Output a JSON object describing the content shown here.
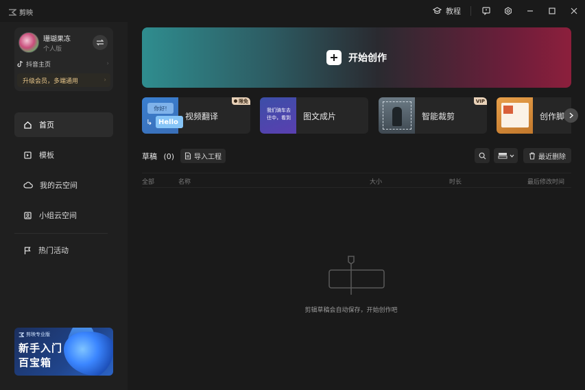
{
  "app": {
    "logo_text": "剪映"
  },
  "titlebar": {
    "tutorial_label": "教程"
  },
  "sidebar": {
    "user": {
      "name": "珊瑚果冻",
      "tier": "个人版"
    },
    "douyin_label": "抖音主页",
    "upgrade_label": "升级会员，多端通用",
    "nav": [
      {
        "label": "首页",
        "icon": "home-icon",
        "active": true
      },
      {
        "label": "模板",
        "icon": "template-icon",
        "active": false
      },
      {
        "label": "我的云空间",
        "icon": "cloud-icon",
        "active": false
      },
      {
        "label": "小组云空间",
        "icon": "team-cloud-icon",
        "active": false
      },
      {
        "label": "热门活动",
        "icon": "flag-icon",
        "active": false
      }
    ],
    "promo": {
      "brand": "剪映专业版",
      "line1": "新手入门",
      "line2": "百宝箱"
    }
  },
  "hero": {
    "label": "开始创作"
  },
  "tools": [
    {
      "label": "视频翻译",
      "badge": "限免",
      "thumb_text_1": "你好!",
      "thumb_text_2": "Hello"
    },
    {
      "label": "图文成片",
      "thumb_text": "我们骑车去往中，看到"
    },
    {
      "label": "智能裁剪",
      "badge": "VIP"
    },
    {
      "label": "创作脚本"
    }
  ],
  "drafts": {
    "title": "草稿",
    "count": "(0)",
    "import_label": "导入工程",
    "recent_delete_label": "最近删除"
  },
  "table": {
    "columns": [
      "全部",
      "名称",
      "大小",
      "时长",
      "最后修改时间"
    ]
  },
  "empty": {
    "message": "剪辑草稿会自动保存，开始创作吧"
  },
  "colors": {
    "background": "#1a1a1a",
    "sidebar": "#1f1f1f",
    "accent_gold": "#e8c68a"
  }
}
